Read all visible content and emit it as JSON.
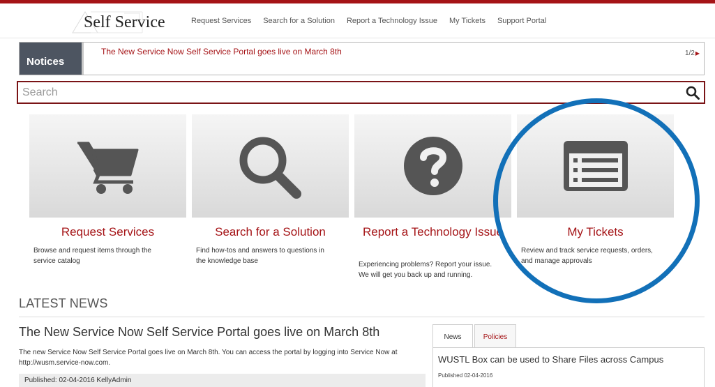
{
  "header": {
    "logo_text": "Self Service",
    "nav": [
      {
        "label": "Request Services"
      },
      {
        "label": "Search for a Solution"
      },
      {
        "label": "Report a Technology Issue"
      },
      {
        "label": "My Tickets"
      },
      {
        "label": "Support Portal"
      }
    ]
  },
  "notices": {
    "label": "Notices",
    "text": "The New Service Now Self Service Portal goes live on March 8th",
    "pager": "1/2"
  },
  "search": {
    "placeholder": "Search"
  },
  "cards": [
    {
      "title": "Request Services",
      "description": "Browse and request items through the service catalog",
      "icon": "shopping-cart-icon"
    },
    {
      "title": "Search for a Solution",
      "description": "Find how-tos and answers to questions in the knowledge base",
      "icon": "magnifier-icon"
    },
    {
      "title": "Report a Technology Issue",
      "description": "Experiencing problems? Report your issue. We will get you back up and running.",
      "icon": "question-icon"
    },
    {
      "title": "My Tickets",
      "description": "Review and track service requests, orders, and manage approvals",
      "icon": "ticket-list-icon"
    }
  ],
  "news": {
    "heading": "LATEST NEWS",
    "article": {
      "title": "The New Service Now Self Service Portal goes live on March 8th",
      "body": "The new Service Now Self Service Portal goes live on March 8th. You can access the portal by logging into Service Now at http://wusm.service-now.com.",
      "published": "Published: 02-04-2016 KellyAdmin"
    },
    "tabs": [
      {
        "label": "News"
      },
      {
        "label": "Policies"
      }
    ],
    "panel": {
      "title": "WUSTL Box can be used to Share Files across Campus",
      "date": "Published 02-04-2016"
    }
  },
  "colors": {
    "brand_red": "#a51417",
    "notice_label_bg": "#4d5561",
    "highlight_circle": "#1270b8",
    "icon_gray": "#555555"
  }
}
